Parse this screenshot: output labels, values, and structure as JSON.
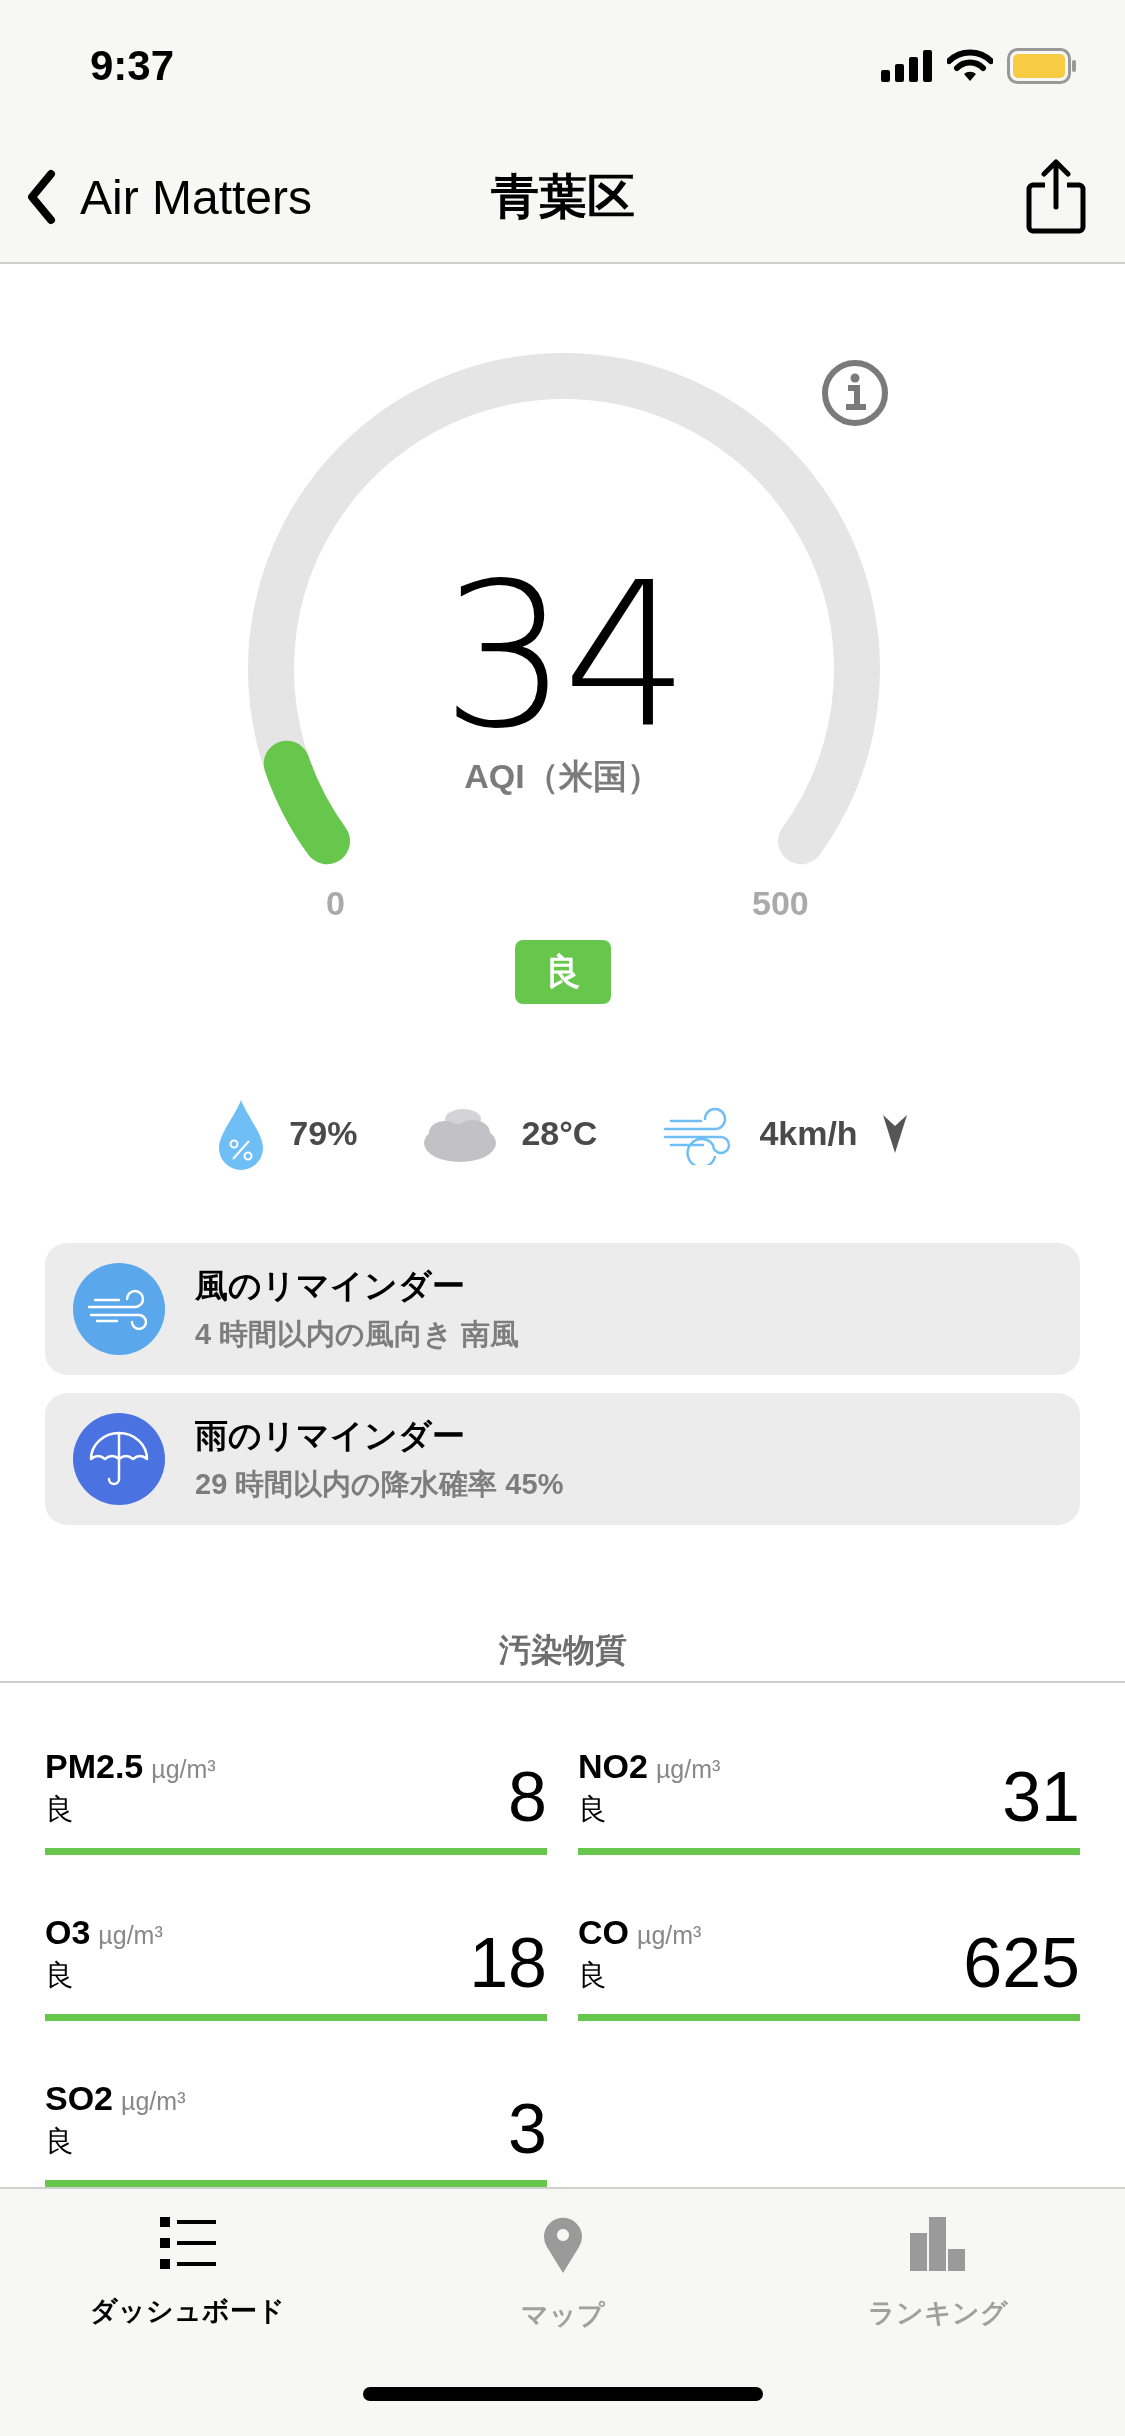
{
  "status_bar": {
    "time": "9:37"
  },
  "nav": {
    "back": "Air Matters",
    "title": "青葉区"
  },
  "aqi": {
    "value": "34",
    "label": "AQI（米国）",
    "min": "0",
    "max": "500",
    "level": 0.068,
    "category": "良"
  },
  "weather": [
    {
      "kind": "humidity",
      "text": "79%"
    },
    {
      "kind": "temperature",
      "text": "28°C"
    },
    {
      "kind": "wind",
      "text": "4km/h"
    }
  ],
  "reminders": [
    {
      "kind": "wind",
      "title": "風のリマインダー",
      "detail": "4 時間以内の風向き 南風"
    },
    {
      "kind": "rain",
      "title": "雨のリマインダー",
      "detail": "29 時間以内の降水確率 45%"
    }
  ],
  "pollutants_title": "汚染物質",
  "pollutants": [
    {
      "name": "PM2.5",
      "unit": "µg/m³",
      "status": "良",
      "value": "8"
    },
    {
      "name": "NO2",
      "unit": "µg/m³",
      "status": "良",
      "value": "31"
    },
    {
      "name": "O3",
      "unit": "µg/m³",
      "status": "良",
      "value": "18"
    },
    {
      "name": "CO",
      "unit": "µg/m³",
      "status": "良",
      "value": "625"
    },
    {
      "name": "SO2",
      "unit": "µg/m³",
      "status": "良",
      "value": "3"
    }
  ],
  "tabs": [
    {
      "kind": "dashboard",
      "label": "ダッシュボード",
      "selected": true
    },
    {
      "kind": "map",
      "label": "マップ",
      "selected": false
    },
    {
      "kind": "ranking",
      "label": "ランキング",
      "selected": false
    }
  ]
}
